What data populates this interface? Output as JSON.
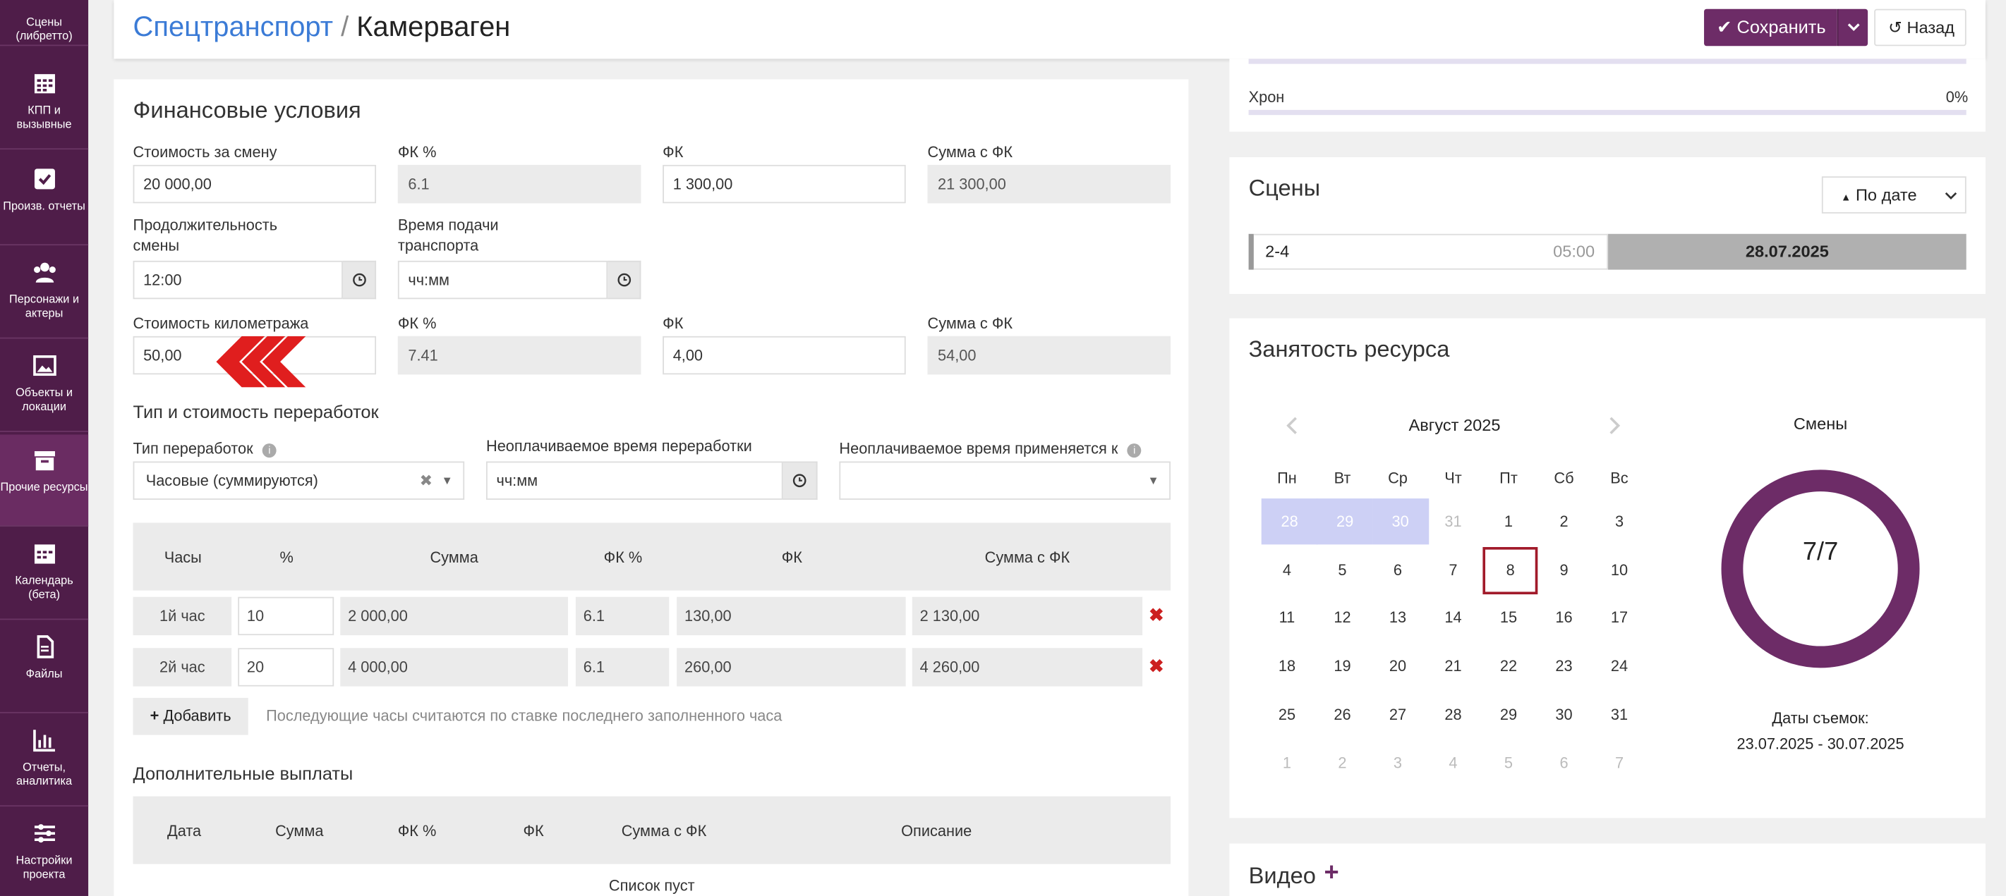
{
  "sidebar": {
    "items": [
      {
        "label": "Сцены (либретто)",
        "icon": "scenes-icon"
      },
      {
        "label": "КПП и вызывные",
        "icon": "calendar-grid-icon"
      },
      {
        "label": "Произв. отчеты",
        "icon": "checkbox-icon"
      },
      {
        "label": "Персонажи и актеры",
        "icon": "users-icon"
      },
      {
        "label": "Объекты и локации",
        "icon": "image-icon"
      },
      {
        "label": "Прочие ресурсы",
        "icon": "archive-icon"
      },
      {
        "label": "Календарь (бета)",
        "icon": "calendar-icon"
      },
      {
        "label": "Файлы",
        "icon": "file-icon"
      },
      {
        "label": "Отчеты, аналитика",
        "icon": "bar-chart-icon"
      },
      {
        "label": "Настройки проекта",
        "icon": "sliders-icon"
      }
    ]
  },
  "header": {
    "section": "Спецтранспорт",
    "separator": "/",
    "title": "Камерваген",
    "save_label": "Сохранить",
    "back_label": "Назад"
  },
  "finance": {
    "title": "Финансовые условия",
    "row1": {
      "cost_label": "Стоимость за смену",
      "cost_value": "20 000,00",
      "fk_pct_label": "ФК %",
      "fk_pct_value": "6.1",
      "fk_label": "ФК",
      "fk_value": "1 300,00",
      "sum_label": "Сумма с ФК",
      "sum_value": "21 300,00"
    },
    "row2": {
      "duration_label_1": "Продолжительность",
      "duration_label_2": "смены",
      "duration_value": "12:00",
      "delivery_label_1": "Время подачи",
      "delivery_label_2": "транспорта",
      "delivery_placeholder": "чч:мм"
    },
    "row3": {
      "km_label": "Стоимость километража",
      "km_value": "50,00",
      "fk_pct_label": "ФК %",
      "fk_pct_value": "7.41",
      "fk_label": "ФК",
      "fk_value": "4,00",
      "sum_label": "Сумма с ФК",
      "sum_value": "54,00"
    },
    "overtime": {
      "title": "Тип и стоимость переработок",
      "type_label": "Тип переработок",
      "type_value": "Часовые (суммируются)",
      "unpaid_label": "Неоплачиваемое время переработки",
      "unpaid_placeholder": "чч:мм",
      "applies_label": "Неоплачиваемое время применяется к",
      "columns": [
        "Часы",
        "%",
        "Сумма",
        "ФК %",
        "ФК",
        "Сумма с ФК"
      ],
      "rows": [
        {
          "hour": "1й час",
          "pct": "10",
          "sum": "2 000,00",
          "fk_pct": "6.1",
          "fk": "130,00",
          "total": "2 130,00"
        },
        {
          "hour": "2й час",
          "pct": "20",
          "sum": "4 000,00",
          "fk_pct": "6.1",
          "fk": "260,00",
          "total": "4 260,00"
        }
      ],
      "add_label": "Добавить",
      "hint": "Последующие часы считаются по ставке последнего заполненного часа"
    },
    "extra": {
      "title": "Дополнительные выплаты",
      "columns": [
        "Дата",
        "Сумма",
        "ФК %",
        "ФК",
        "Сумма с ФК",
        "Описание"
      ],
      "empty": "Список пуст"
    }
  },
  "right": {
    "chron_label": "Хрон",
    "chron_value": "0%",
    "scenes": {
      "title": "Сцены",
      "sort_label": "По дате",
      "items": [
        {
          "name": "2-4",
          "time": "05:00",
          "date": "28.07.2025"
        }
      ]
    },
    "occupancy": {
      "title": "Занятость ресурса",
      "month": "Август 2025",
      "weekdays": [
        "Пн",
        "Вт",
        "Ср",
        "Чт",
        "Пт",
        "Сб",
        "Вс"
      ],
      "weeks": [
        [
          "28",
          "29",
          "30",
          "31",
          "1",
          "2",
          "3"
        ],
        [
          "4",
          "5",
          "6",
          "7",
          "8",
          "9",
          "10"
        ],
        [
          "11",
          "12",
          "13",
          "14",
          "15",
          "16",
          "17"
        ],
        [
          "18",
          "19",
          "20",
          "21",
          "22",
          "23",
          "24"
        ],
        [
          "25",
          "26",
          "27",
          "28",
          "29",
          "30",
          "31"
        ],
        [
          "1",
          "2",
          "3",
          "4",
          "5",
          "6",
          "7"
        ]
      ],
      "today": "8",
      "shifts_label": "Смены",
      "shifts_value": "7/7",
      "shifts_fraction": 1.0,
      "dates_label": "Даты съемок:",
      "dates_value": "23.07.2025 - 30.07.2025"
    },
    "video_title": "Видео"
  },
  "colors": {
    "sidebar": "#4f1d49",
    "accent": "#6d2c67",
    "link": "#3b7bd6",
    "delete": "#cc1f1f",
    "prev_month_highlight": "#cdd0f5",
    "today_border": "#a11a2a"
  }
}
